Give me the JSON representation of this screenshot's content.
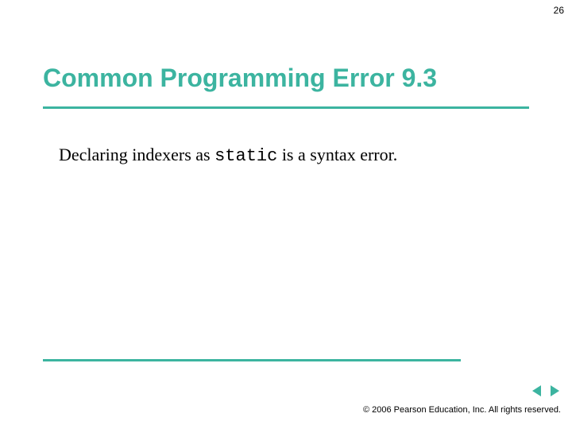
{
  "page_number": "26",
  "title": "Common Programming Error 9.3",
  "body": {
    "prefix": "Declaring indexers as ",
    "code": "static",
    "suffix": " is a syntax error."
  },
  "copyright": "© 2006 Pearson Education, Inc.  All rights reserved.",
  "colors": {
    "accent": "#3cb4a0"
  }
}
